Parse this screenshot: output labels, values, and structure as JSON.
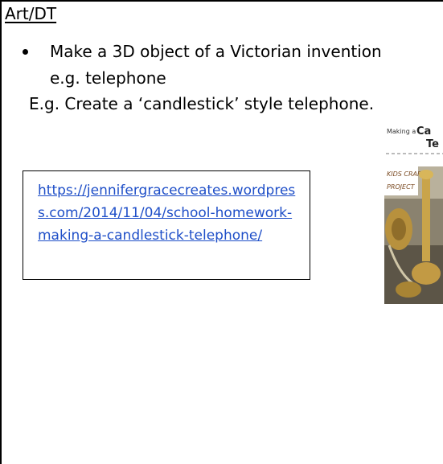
{
  "section": {
    "heading": "Art/DT"
  },
  "task": {
    "bullet_text": "Make a 3D object of a Victorian invention e.g. telephone",
    "example_text": "E.g. Create a ‘candlestick’ style telephone."
  },
  "resource": {
    "link_text": "https://jennifergracecreates.wordpress.com/2014/11/04/school-homework-making-a-candlestick-telephone/",
    "link_color": "#1f4fc8"
  },
  "thumbnail": {
    "title_small": "Making a",
    "title_large_1": "Ca",
    "title_large_2": "Te",
    "badge_line_1": "KIDS CRAFT",
    "badge_line_2": "PROJECT"
  }
}
